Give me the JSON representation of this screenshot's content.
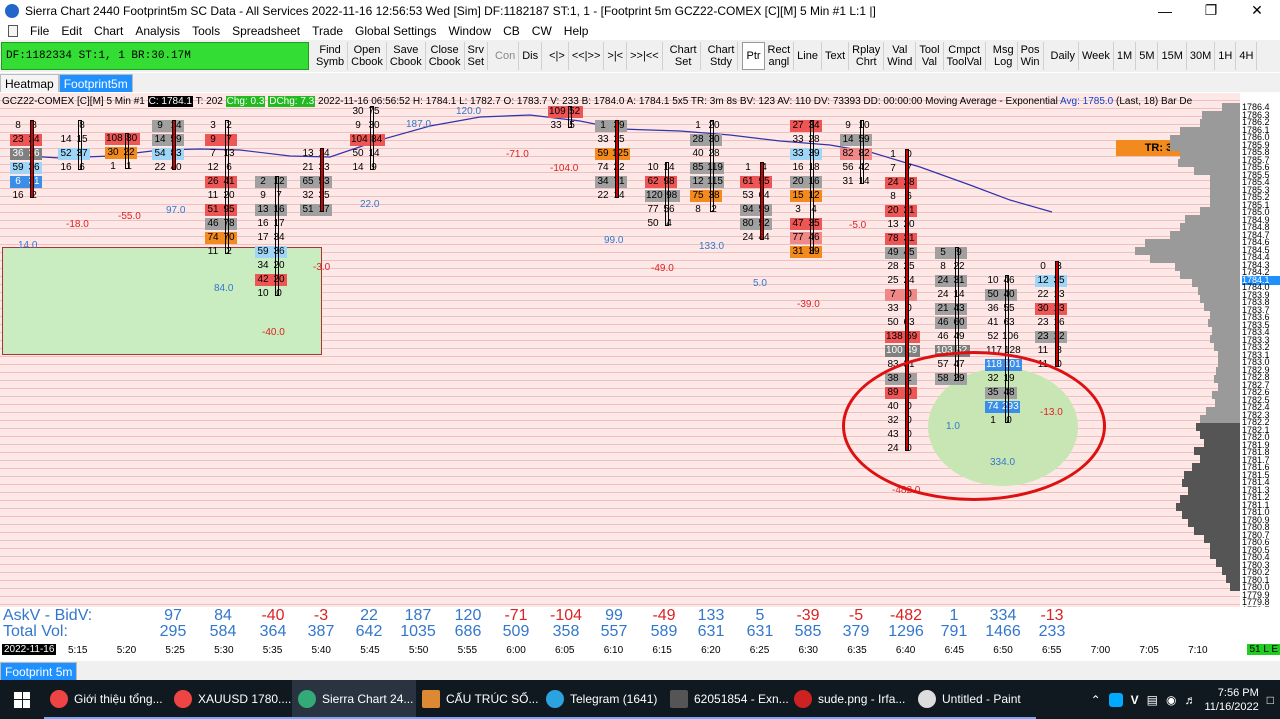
{
  "window": {
    "title": "Sierra Chart 2440 Footprint5m  SC Data - All Services 2022-11-16  12:56:53 Wed [Sim]  DF:1182187  ST:1, 1 - [Footprint 5m GCZ22-COMEX [C][M]  5 Min  #1 L:1 |]"
  },
  "menu": [
    "File",
    "Edit",
    "Chart",
    "Analysis",
    "Tools",
    "Spreadsheet",
    "Trade",
    "Global Settings",
    "Window",
    "CB",
    "CW",
    "Help"
  ],
  "toolbar": {
    "status": "DF:1182334  ST:1, 1   BR:30.17M",
    "buttons": [
      {
        "l1": "Find",
        "l2": "Symb"
      },
      {
        "l1": "Open",
        "l2": "Cbook"
      },
      {
        "l1": "Save",
        "l2": "Cbook"
      },
      {
        "l1": "Close",
        "l2": "Cbook"
      },
      {
        "l1": "Srv",
        "l2": "Set"
      },
      {
        "l1": "Con",
        "l2": ""
      },
      {
        "l1": "Dis",
        "l2": ""
      },
      {
        "l1": "<|>",
        "l2": ""
      },
      {
        "l1": "<<|>>",
        "l2": ""
      },
      {
        "l1": ">|<",
        "l2": ""
      },
      {
        "l1": ">>|<<",
        "l2": ""
      },
      {
        "l1": "Chart",
        "l2": "Set"
      },
      {
        "l1": "Chart",
        "l2": "Stdy"
      },
      {
        "l1": "Ptr",
        "l2": ""
      },
      {
        "l1": "Rect",
        "l2": "angl"
      },
      {
        "l1": "Line",
        "l2": ""
      },
      {
        "l1": "Text",
        "l2": ""
      },
      {
        "l1": "Rplay",
        "l2": "Chrt"
      },
      {
        "l1": "Val",
        "l2": "Wind"
      },
      {
        "l1": "Tool",
        "l2": "Val"
      },
      {
        "l1": "Cmpct",
        "l2": "ToolVal"
      },
      {
        "l1": "Msg",
        "l2": "Log"
      },
      {
        "l1": "Pos",
        "l2": "Win"
      },
      {
        "l1": "Daily",
        "l2": ""
      },
      {
        "l1": "Week",
        "l2": ""
      },
      {
        "l1": "1M",
        "l2": ""
      },
      {
        "l1": "5M",
        "l2": ""
      },
      {
        "l1": "15M",
        "l2": ""
      },
      {
        "l1": "30M",
        "l2": ""
      },
      {
        "l1": "1H",
        "l2": ""
      },
      {
        "l1": "4H",
        "l2": ""
      }
    ]
  },
  "tabs": [
    "Heatmap",
    "Footprint5m"
  ],
  "chart": {
    "symbol": "GCZ22-COMEX [C][M]",
    "interval": "5 Min",
    "num": "#1",
    "close_box": "C: 1784.1",
    "t_field": "T: 202",
    "chg": "Chg: 0.3",
    "dchg": "DChg: 7.3",
    "info": "2022-11-16 06:56:52 H: 1784.1 L: 1782.7 O: 1783.7 V: 233 B: 1784.0 A: 1784.1 5x5 TR: 3m 8s BV: 123 AV: 110 DV: 73393 DD: 00:00:00 Moving Average - Exponential",
    "avg": "Avg: 1785.0",
    "last": "(Last, 18)  Bar De",
    "tr_box": "TR: 3m 8s"
  },
  "price_scale": [
    "1786.4",
    "1786.3",
    "1786.2",
    "1786.1",
    "1786.0",
    "1785.9",
    "1785.8",
    "1785.7",
    "1785.6",
    "1785.5",
    "1785.4",
    "1785.3",
    "1785.2",
    "1785.1",
    "1785.0",
    "1784.9",
    "1784.8",
    "1784.7",
    "1784.6",
    "1784.5",
    "1784.4",
    "1784.3",
    "1784.2",
    "1784.1",
    "1784.0",
    "1783.9",
    "1783.8",
    "1783.7",
    "1783.6",
    "1783.5",
    "1783.4",
    "1783.3",
    "1783.2",
    "1783.1",
    "1783.0",
    "1782.9",
    "1782.8",
    "1782.7",
    "1782.6",
    "1782.5",
    "1782.4",
    "1782.3",
    "1782.2",
    "1782.1",
    "1782.0",
    "1781.9",
    "1781.8",
    "1781.7",
    "1781.6",
    "1781.5",
    "1781.4",
    "1781.3",
    "1781.2",
    "1781.1",
    "1781.0",
    "1780.9",
    "1780.8",
    "1780.7",
    "1780.6",
    "1780.5",
    "1780.4",
    "1780.3",
    "1780.2",
    "1780.1",
    "1780.0",
    "1779.9",
    "1779.8",
    "1779.7"
  ],
  "current_price": "1784.1",
  "notes": [
    {
      "t": "-18.0",
      "c": "neg"
    },
    {
      "t": "-55.0",
      "c": "neg"
    },
    {
      "t": "97.0",
      "c": "pos"
    },
    {
      "t": "14.0",
      "c": "pos"
    },
    {
      "t": "84.0",
      "c": "pos"
    },
    {
      "t": "-40.0",
      "c": "neg"
    },
    {
      "t": "-3.0",
      "c": "neg"
    },
    {
      "t": "22.0",
      "c": "pos"
    },
    {
      "t": "187.0",
      "c": "pos"
    },
    {
      "t": "120.0",
      "c": "pos"
    },
    {
      "t": "-71.0",
      "c": "neg"
    },
    {
      "t": "-104.0",
      "c": "neg"
    },
    {
      "t": "99.0",
      "c": "pos"
    },
    {
      "t": "-49.0",
      "c": "neg"
    },
    {
      "t": "133.0",
      "c": "pos"
    },
    {
      "t": "5.0",
      "c": "pos"
    },
    {
      "t": "-39.0",
      "c": "neg"
    },
    {
      "t": "-5.0",
      "c": "neg"
    },
    {
      "t": "1.0",
      "c": "pos"
    },
    {
      "t": "334.0",
      "c": "pos"
    },
    {
      "t": "-13.0",
      "c": "neg"
    },
    {
      "t": "-482.0",
      "c": "neg"
    }
  ],
  "summary": {
    "askv_label": "AskV - BidV:",
    "total_label": "Total Vol:",
    "askv": [
      "97",
      "84",
      "-40",
      "-3",
      "22",
      "187",
      "120",
      "-71",
      "-104",
      "99",
      "-49",
      "133",
      "5",
      "-39",
      "-5",
      "-482",
      "1",
      "334",
      "-13"
    ],
    "total": [
      "295",
      "584",
      "364",
      "387",
      "642",
      "1035",
      "686",
      "509",
      "358",
      "557",
      "589",
      "631",
      "631",
      "585",
      "379",
      "1296",
      "791",
      "1466",
      "233"
    ]
  },
  "time_axis": {
    "date": "2022-11-16",
    "labels": [
      "5:15",
      "5:20",
      "5:25",
      "5:30",
      "5:35",
      "5:40",
      "5:45",
      "5:50",
      "5:55",
      "6:00",
      "6:05",
      "6:10",
      "6:15",
      "6:20",
      "6:25",
      "6:30",
      "6:35",
      "6:40",
      "6:45",
      "6:50",
      "6:55",
      "7:00",
      "7:05",
      "7:10"
    ],
    "zoom": "51 L E"
  },
  "chart_tab": "Footprint 5m",
  "taskbar": {
    "items": [
      "Giới thiệu tổng...",
      "XAUUSD 1780....",
      "Sierra Chart 24...",
      "CẤU TRÚC SỐ...",
      "Telegram (1641)",
      "62051854 - Exn...",
      "sude.png - Irfa...",
      "Untitled - Paint"
    ],
    "telegram_badge": "41",
    "time": "7:56 PM",
    "date": "11/16/2022",
    "lang": "V"
  }
}
